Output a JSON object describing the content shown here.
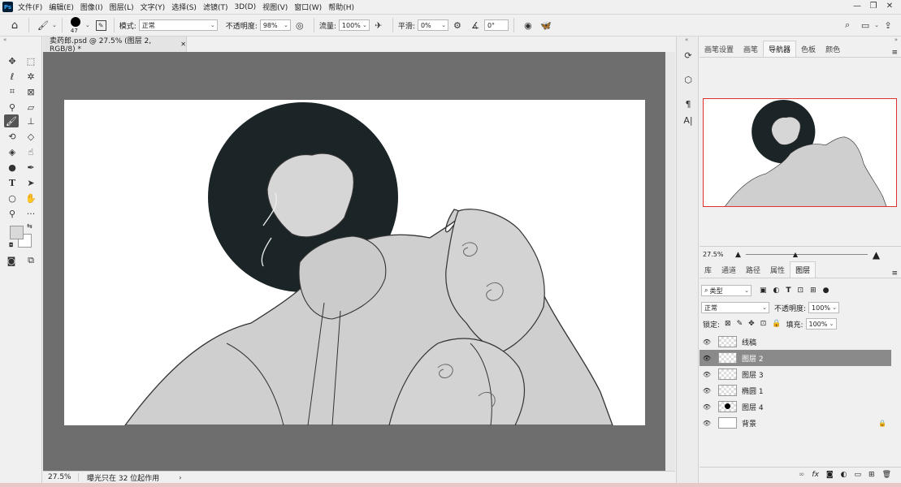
{
  "app": {
    "logo": "Ps"
  },
  "menu": [
    "文件(F)",
    "编辑(E)",
    "图像(I)",
    "图层(L)",
    "文字(Y)",
    "选择(S)",
    "滤镜(T)",
    "3D(D)",
    "视图(V)",
    "窗口(W)",
    "帮助(H)"
  ],
  "options": {
    "brush_size": "47",
    "mode_label": "模式:",
    "mode_value": "正常",
    "opacity_label": "不透明度:",
    "opacity_value": "98%",
    "flow_label": "流量:",
    "flow_value": "100%",
    "smoothing_label": "平滑:",
    "smoothing_value": "0%",
    "angle_value": "0°"
  },
  "document": {
    "tab_title": "卖药郎.psd @ 27.5% (图层 2, RGB/8) *",
    "zoom": "27.5%",
    "status_text": "曝光只在 32 位起作用"
  },
  "navigator": {
    "tabs": [
      "画笔设置",
      "画笔",
      "导航器",
      "色板",
      "颜色"
    ],
    "active_tab": "导航器",
    "zoom": "27.5%"
  },
  "layers_panel": {
    "tabs": [
      "库",
      "通道",
      "路径",
      "属性",
      "图层"
    ],
    "active_tab": "图层",
    "filter_label": "类型",
    "blend_mode": "正常",
    "opacity_label": "不透明度:",
    "opacity_value": "100%",
    "lock_label": "锁定:",
    "fill_label": "填充:",
    "fill_value": "100%",
    "layers": [
      {
        "name": "线稿",
        "selected": false
      },
      {
        "name": "图层 2",
        "selected": true
      },
      {
        "name": "图层 3",
        "selected": false
      },
      {
        "name": "椭圆 1",
        "selected": false
      },
      {
        "name": "图层 4",
        "selected": false
      },
      {
        "name": "背景",
        "selected": false,
        "locked": true
      }
    ]
  },
  "colors": {
    "accent": "#e03030",
    "circle": "#1b2426",
    "robe": "#cfcfcf",
    "workspace": "#6e6e6e"
  }
}
